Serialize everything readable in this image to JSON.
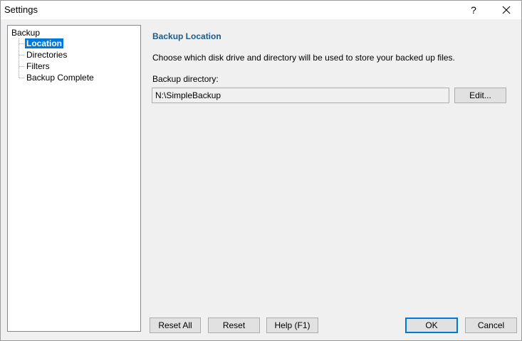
{
  "window": {
    "title": "Settings",
    "help_label": "?"
  },
  "tree": {
    "root": "Backup",
    "items": [
      {
        "label": "Location",
        "selected": true
      },
      {
        "label": "Directories",
        "selected": false
      },
      {
        "label": "Filters",
        "selected": false
      },
      {
        "label": "Backup Complete",
        "selected": false
      }
    ]
  },
  "panel": {
    "title": "Backup Location",
    "description": "Choose which disk drive and directory will be used to store your backed up files.",
    "field_label": "Backup directory:",
    "directory_value": "N:\\SimpleBackup",
    "edit_label": "Edit..."
  },
  "footer": {
    "reset_all": "Reset All",
    "reset": "Reset",
    "help": "Help (F1)",
    "ok": "OK",
    "cancel": "Cancel"
  },
  "colors": {
    "selection": "#0078d7",
    "section_title": "#1a5a8c",
    "default_button_border": "#0078d7"
  }
}
